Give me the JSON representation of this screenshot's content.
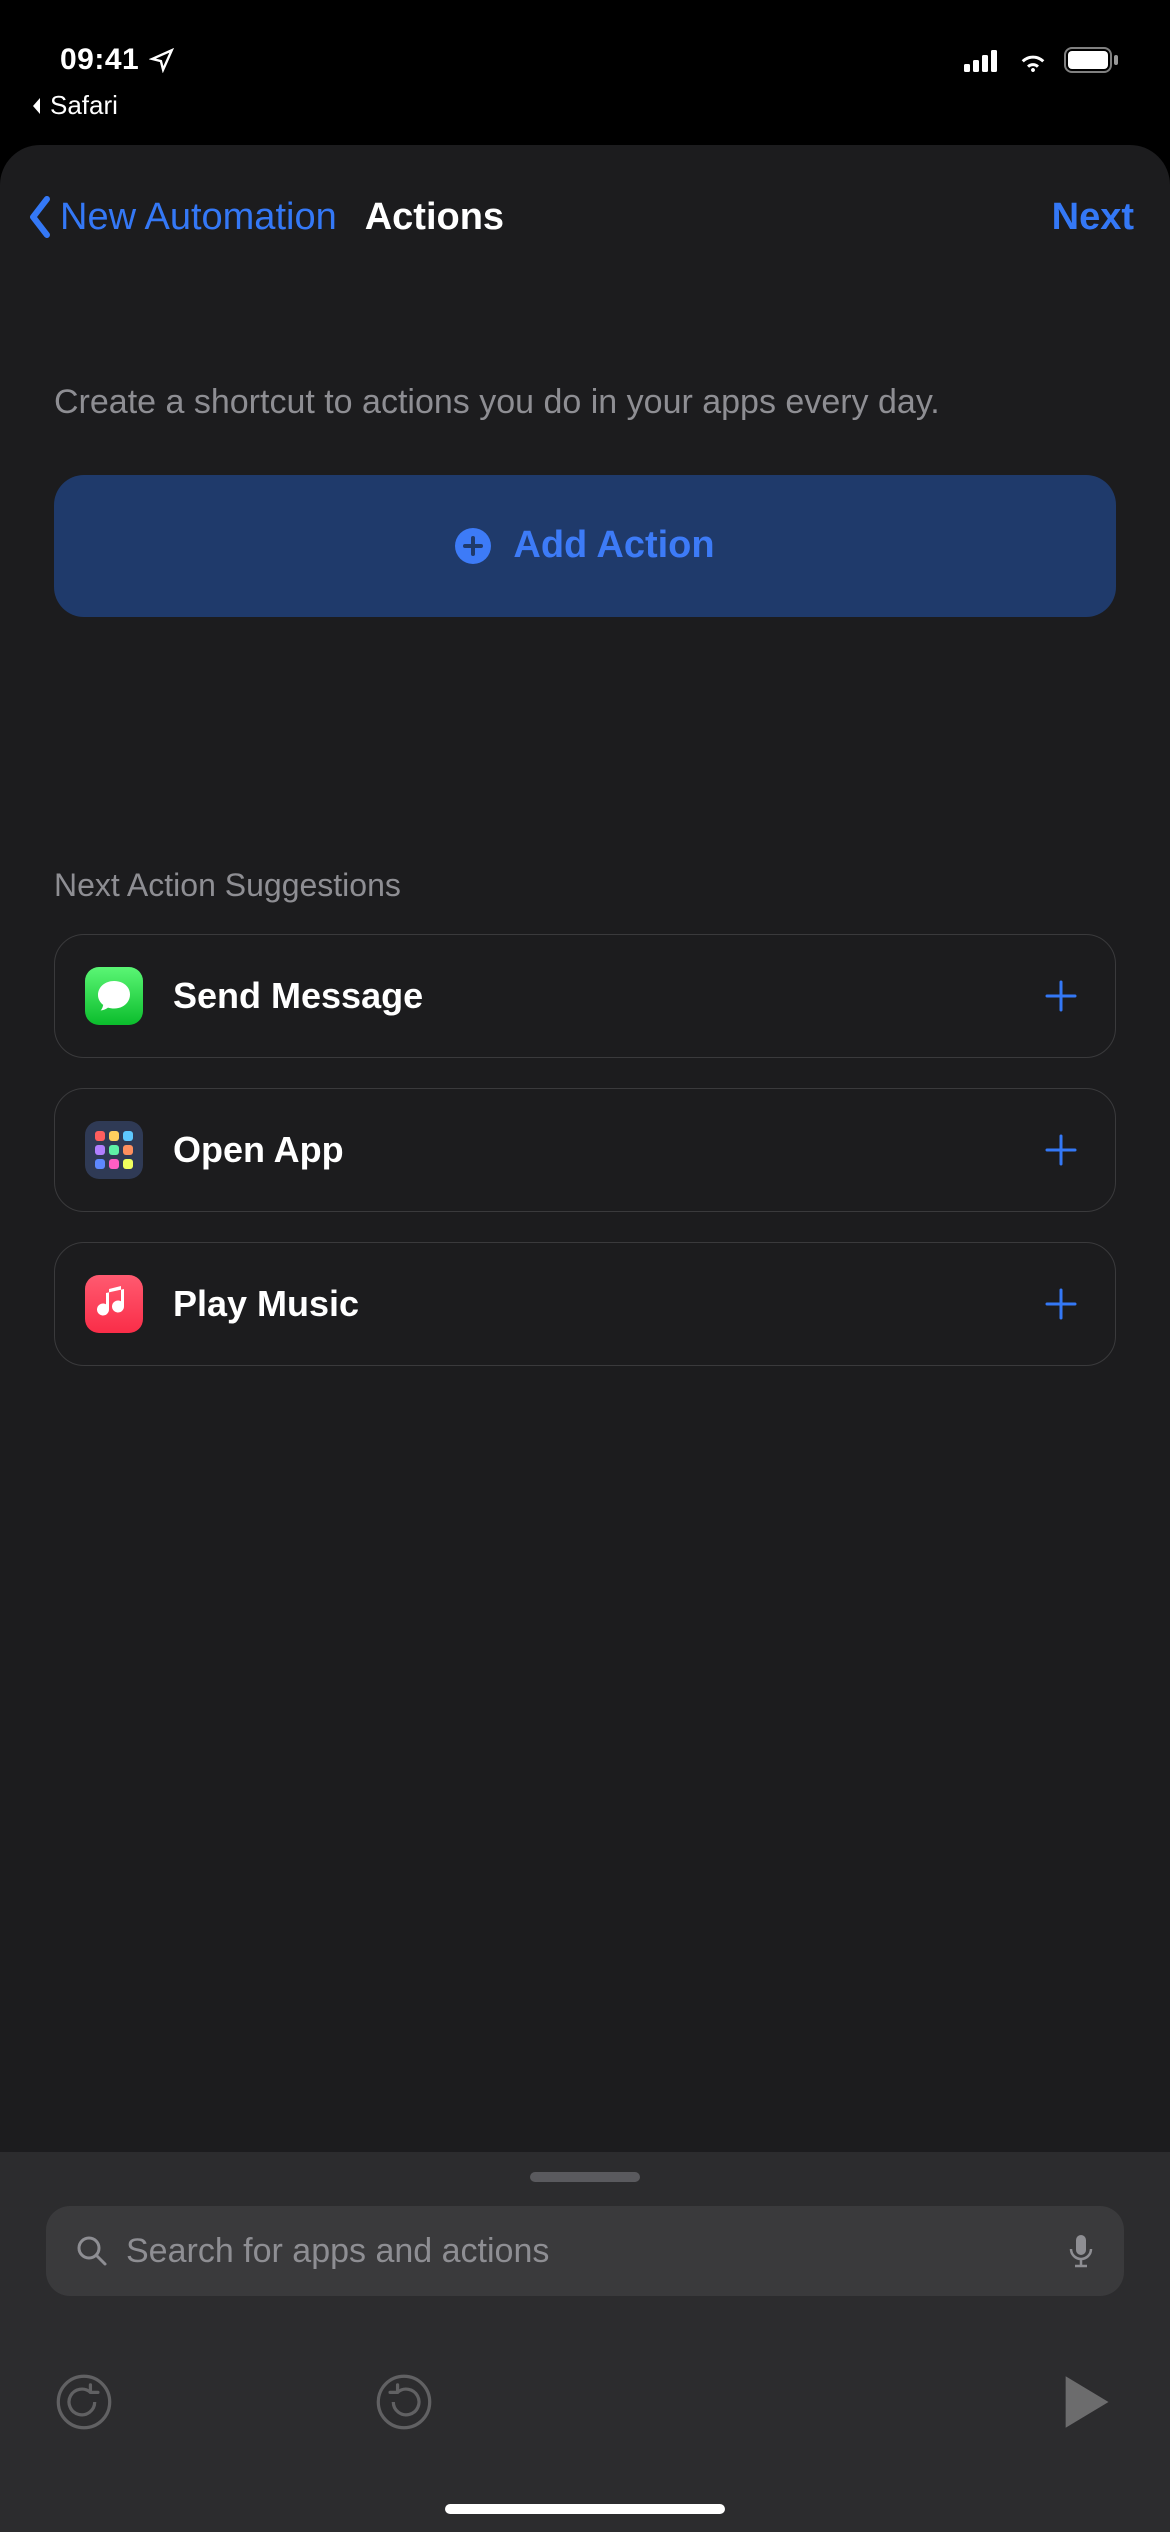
{
  "status": {
    "time": "09:41",
    "back_app": "Safari"
  },
  "nav": {
    "back_label": "New Automation",
    "title": "Actions",
    "next_label": "Next"
  },
  "description": "Create a shortcut to actions you do in your apps every day.",
  "add_action_label": "Add Action",
  "suggestions": {
    "header": "Next Action Suggestions",
    "items": [
      {
        "label": "Send Message",
        "icon": "messages-icon"
      },
      {
        "label": "Open App",
        "icon": "apps-grid-icon"
      },
      {
        "label": "Play Music",
        "icon": "music-icon"
      }
    ]
  },
  "search": {
    "placeholder": "Search for apps and actions"
  }
}
